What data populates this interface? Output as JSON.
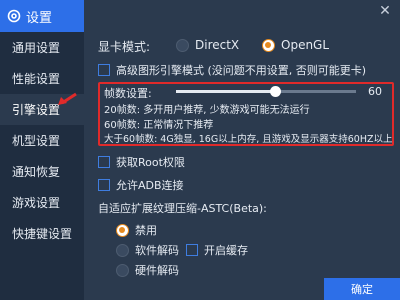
{
  "sidebar": {
    "title": "设置",
    "items": [
      {
        "label": "通用设置"
      },
      {
        "label": "性能设置"
      },
      {
        "label": "引擎设置"
      },
      {
        "label": "机型设置"
      },
      {
        "label": "通知恢复"
      },
      {
        "label": "游戏设置"
      },
      {
        "label": "快捷键设置"
      }
    ],
    "active_index": 2
  },
  "graphics": {
    "label": "显卡模式:",
    "options": [
      "DirectX",
      "OpenGL"
    ],
    "selected": "OpenGL"
  },
  "hd_engine": {
    "label": "高级图形引擎模式 (没问题不用设置, 否则可能更卡)",
    "checked": false
  },
  "fps": {
    "label": "帧数设置:",
    "value": "60",
    "fraction": 1.0,
    "desc1": "20帧数: 多开用户推荐, 少数游戏可能无法运行",
    "desc2": "60帧数: 正常情况下推荐",
    "desc3": "大于60帧数: 4G独显, 16G以上内存, 且游戏及显示器支持60HZ以上"
  },
  "root": {
    "label": "获取Root权限",
    "checked": false
  },
  "adb": {
    "label": "允许ADB连接",
    "checked": false
  },
  "astc": {
    "label": "自适应扩展纹理压缩-ASTC(Beta):",
    "options": [
      "禁用",
      "软件解码",
      "硬件解码"
    ],
    "selected": "禁用",
    "cache_label": "开启缓存",
    "cache_checked": false
  },
  "confirm_label": "确定",
  "colors": {
    "accent": "#2d6fe8",
    "radio_on": "#e58a1f",
    "highlight": "#e02a2a"
  }
}
